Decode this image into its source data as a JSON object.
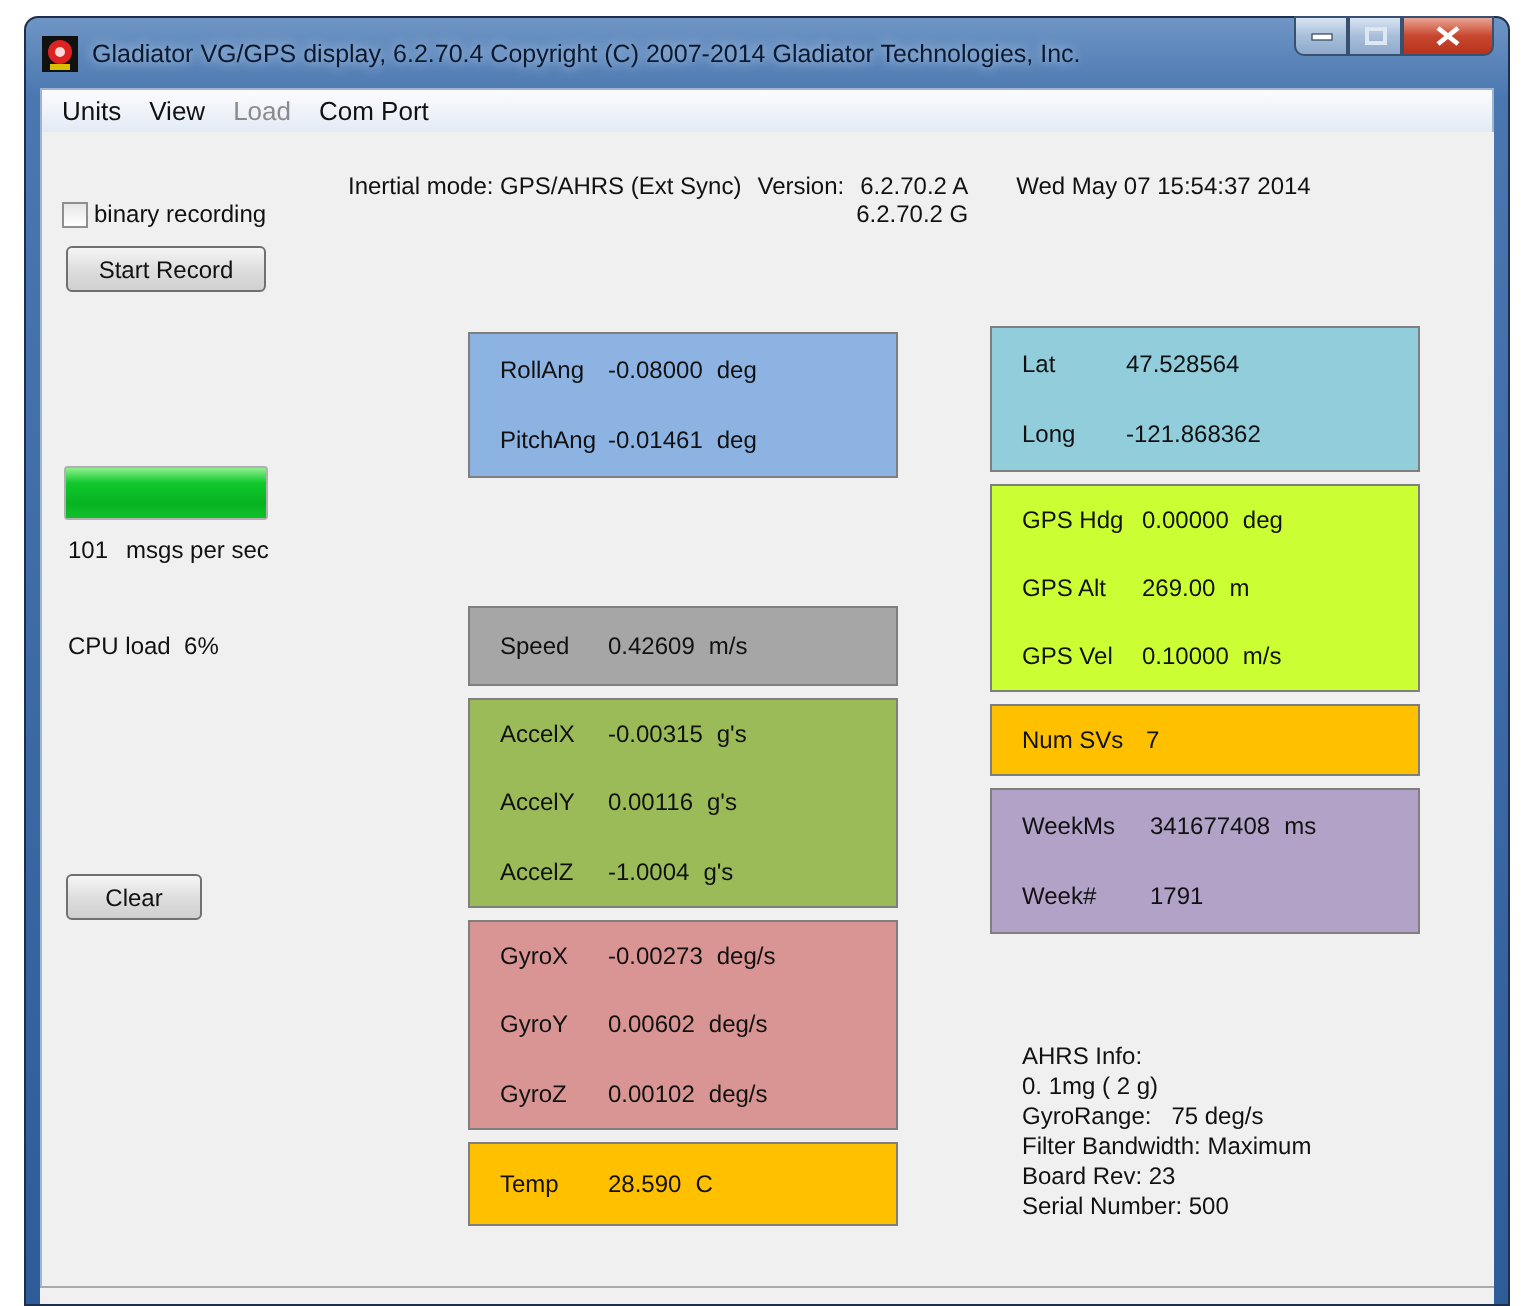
{
  "window": {
    "title": "Gladiator VG/GPS display, 6.2.70.4 Copyright (C) 2007-2014 Gladiator Technologies, Inc."
  },
  "menu": [
    {
      "label": "Units",
      "disabled": false
    },
    {
      "label": "View",
      "disabled": false
    },
    {
      "label": "Load",
      "disabled": true
    },
    {
      "label": "Com Port",
      "disabled": false
    }
  ],
  "header": {
    "mode": "Inertial mode: GPS/AHRS (Ext Sync)",
    "version_label": "Version:",
    "versions": [
      "6.2.70.2 A",
      "6.2.70.2 G"
    ],
    "datetime": "Wed May 07 15:54:37 2014"
  },
  "recording": {
    "label": "binary recording",
    "checked": false
  },
  "start_button": "Start Record",
  "rate_bar": {
    "level": 1.0
  },
  "rate": {
    "value": "101",
    "unit": "msgs per sec"
  },
  "cpu_load": "CPU load  6%",
  "clear_button": "Clear",
  "panels_middle": [
    {
      "color": "#8db3e2",
      "rows": [
        {
          "label": "RollAng",
          "value": "-0.08000",
          "unit": "deg"
        },
        {
          "label": "PitchAng",
          "value": "-0.01461",
          "unit": "deg"
        }
      ]
    },
    {
      "color": "#a6a6a6",
      "rows": [
        {
          "label": "Speed",
          "value": "0.42609",
          "unit": "m/s"
        }
      ]
    },
    {
      "color": "#9bbb59",
      "rows": [
        {
          "label": "AccelX",
          "value": "-0.00315",
          "unit": "g's"
        },
        {
          "label": "AccelY",
          "value": "0.00116",
          "unit": "g's"
        },
        {
          "label": "AccelZ",
          "value": "-1.0004",
          "unit": "g's"
        }
      ]
    },
    {
      "color": "#d99594",
      "rows": [
        {
          "label": "GyroX",
          "value": "-0.00273",
          "unit": "deg/s"
        },
        {
          "label": "GyroY",
          "value": "0.00602",
          "unit": "deg/s"
        },
        {
          "label": "GyroZ",
          "value": "0.00102",
          "unit": "deg/s"
        }
      ]
    },
    {
      "color": "#ffc000",
      "rows": [
        {
          "label": "Temp",
          "value": "28.590",
          "unit": "C"
        }
      ]
    }
  ],
  "panels_right": [
    {
      "color": "#92cddc",
      "rows": [
        {
          "label": "Lat",
          "value": "47.528564"
        },
        {
          "label": "Long",
          "value": "-121.868362"
        }
      ]
    },
    {
      "color": "#ccff33",
      "rows": [
        {
          "label": "GPS Hdg",
          "value": "0.00000",
          "unit": "deg"
        },
        {
          "label": "GPS Alt",
          "value": "269.00",
          "unit": "m"
        },
        {
          "label": "GPS Vel",
          "value": "0.10000",
          "unit": "m/s"
        }
      ]
    },
    {
      "color": "#ffc000",
      "rows": [
        {
          "label": "Num SVs",
          "value": "7"
        }
      ]
    },
    {
      "color": "#b2a2c7",
      "rows": [
        {
          "label": "WeekMs",
          "value": "341677408",
          "unit": "ms"
        },
        {
          "label": "Week#",
          "value": "1791"
        }
      ]
    }
  ],
  "ahrs_info": [
    "AHRS Info:",
    "0. 1mg ( 2 g)",
    "GyroRange:   75 deg/s",
    "Filter Bandwidth: Maximum",
    "Board Rev: 23",
    "Serial Number: 500"
  ]
}
